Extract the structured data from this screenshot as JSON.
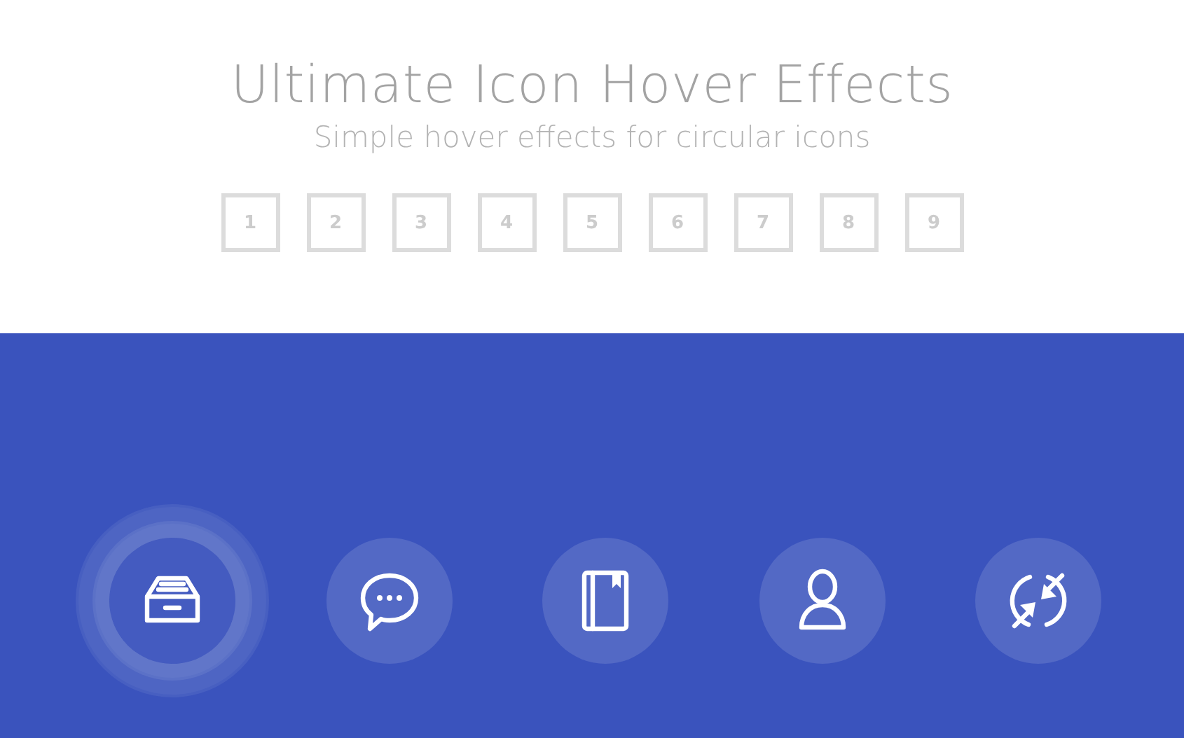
{
  "header": {
    "title": "Ultimate Icon Hover Effects",
    "subtitle": "Simple hover effects for circular icons"
  },
  "pager": [
    "1",
    "2",
    "3",
    "4",
    "5",
    "6",
    "7",
    "8",
    "9"
  ],
  "icons": [
    {
      "kind": "inbox",
      "hovered": true
    },
    {
      "kind": "chat",
      "hovered": false
    },
    {
      "kind": "book",
      "hovered": false
    },
    {
      "kind": "user",
      "hovered": false
    },
    {
      "kind": "sync",
      "hovered": false
    }
  ]
}
